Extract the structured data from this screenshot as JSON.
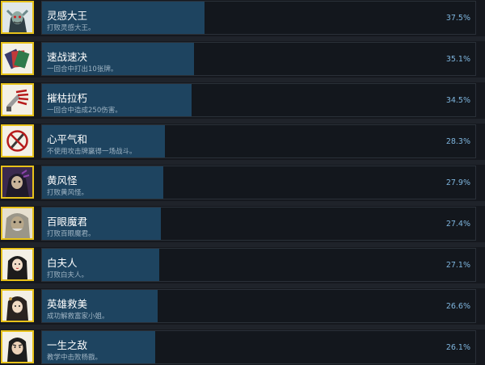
{
  "achievements": [
    {
      "title": "灵感大王",
      "desc": "打败灵感大王。",
      "percent_label": "37.5%",
      "percent": 37.5,
      "icon": "demon-king-portrait-icon"
    },
    {
      "title": "速战速决",
      "desc": "一回合中打出10张牌。",
      "percent_label": "35.1%",
      "percent": 35.1,
      "icon": "card-stack-icon"
    },
    {
      "title": "摧枯拉朽",
      "desc": "一回合中造成250伤害。",
      "percent_label": "34.5%",
      "percent": 34.5,
      "icon": "claw-weapon-icon"
    },
    {
      "title": "心平气和",
      "desc": "不使用攻击牌赢得一场战斗。",
      "percent_label": "28.3%",
      "percent": 28.3,
      "icon": "no-attack-icon"
    },
    {
      "title": "黄风怪",
      "desc": "打败黄风怪。",
      "percent_label": "27.9%",
      "percent": 27.9,
      "icon": "yellow-wind-demon-portrait-icon"
    },
    {
      "title": "百眼魔君",
      "desc": "打败百眼魔君。",
      "percent_label": "27.4%",
      "percent": 27.4,
      "icon": "hundred-eye-demon-portrait-icon"
    },
    {
      "title": "白夫人",
      "desc": "打败白夫人。",
      "percent_label": "27.1%",
      "percent": 27.1,
      "icon": "lady-bai-portrait-icon"
    },
    {
      "title": "英雄救美",
      "desc": "成功解救富家小姐。",
      "percent_label": "26.6%",
      "percent": 26.6,
      "icon": "rescued-lady-portrait-icon"
    },
    {
      "title": "一生之敌",
      "desc": "教学中击败杨戬。",
      "percent_label": "26.1%",
      "percent": 26.1,
      "icon": "lifelong-rival-portrait-icon"
    }
  ],
  "colors": {
    "bar_fill": "#1e4460",
    "icon_border": "#e8c21a",
    "percent_text": "#7fb6df"
  }
}
